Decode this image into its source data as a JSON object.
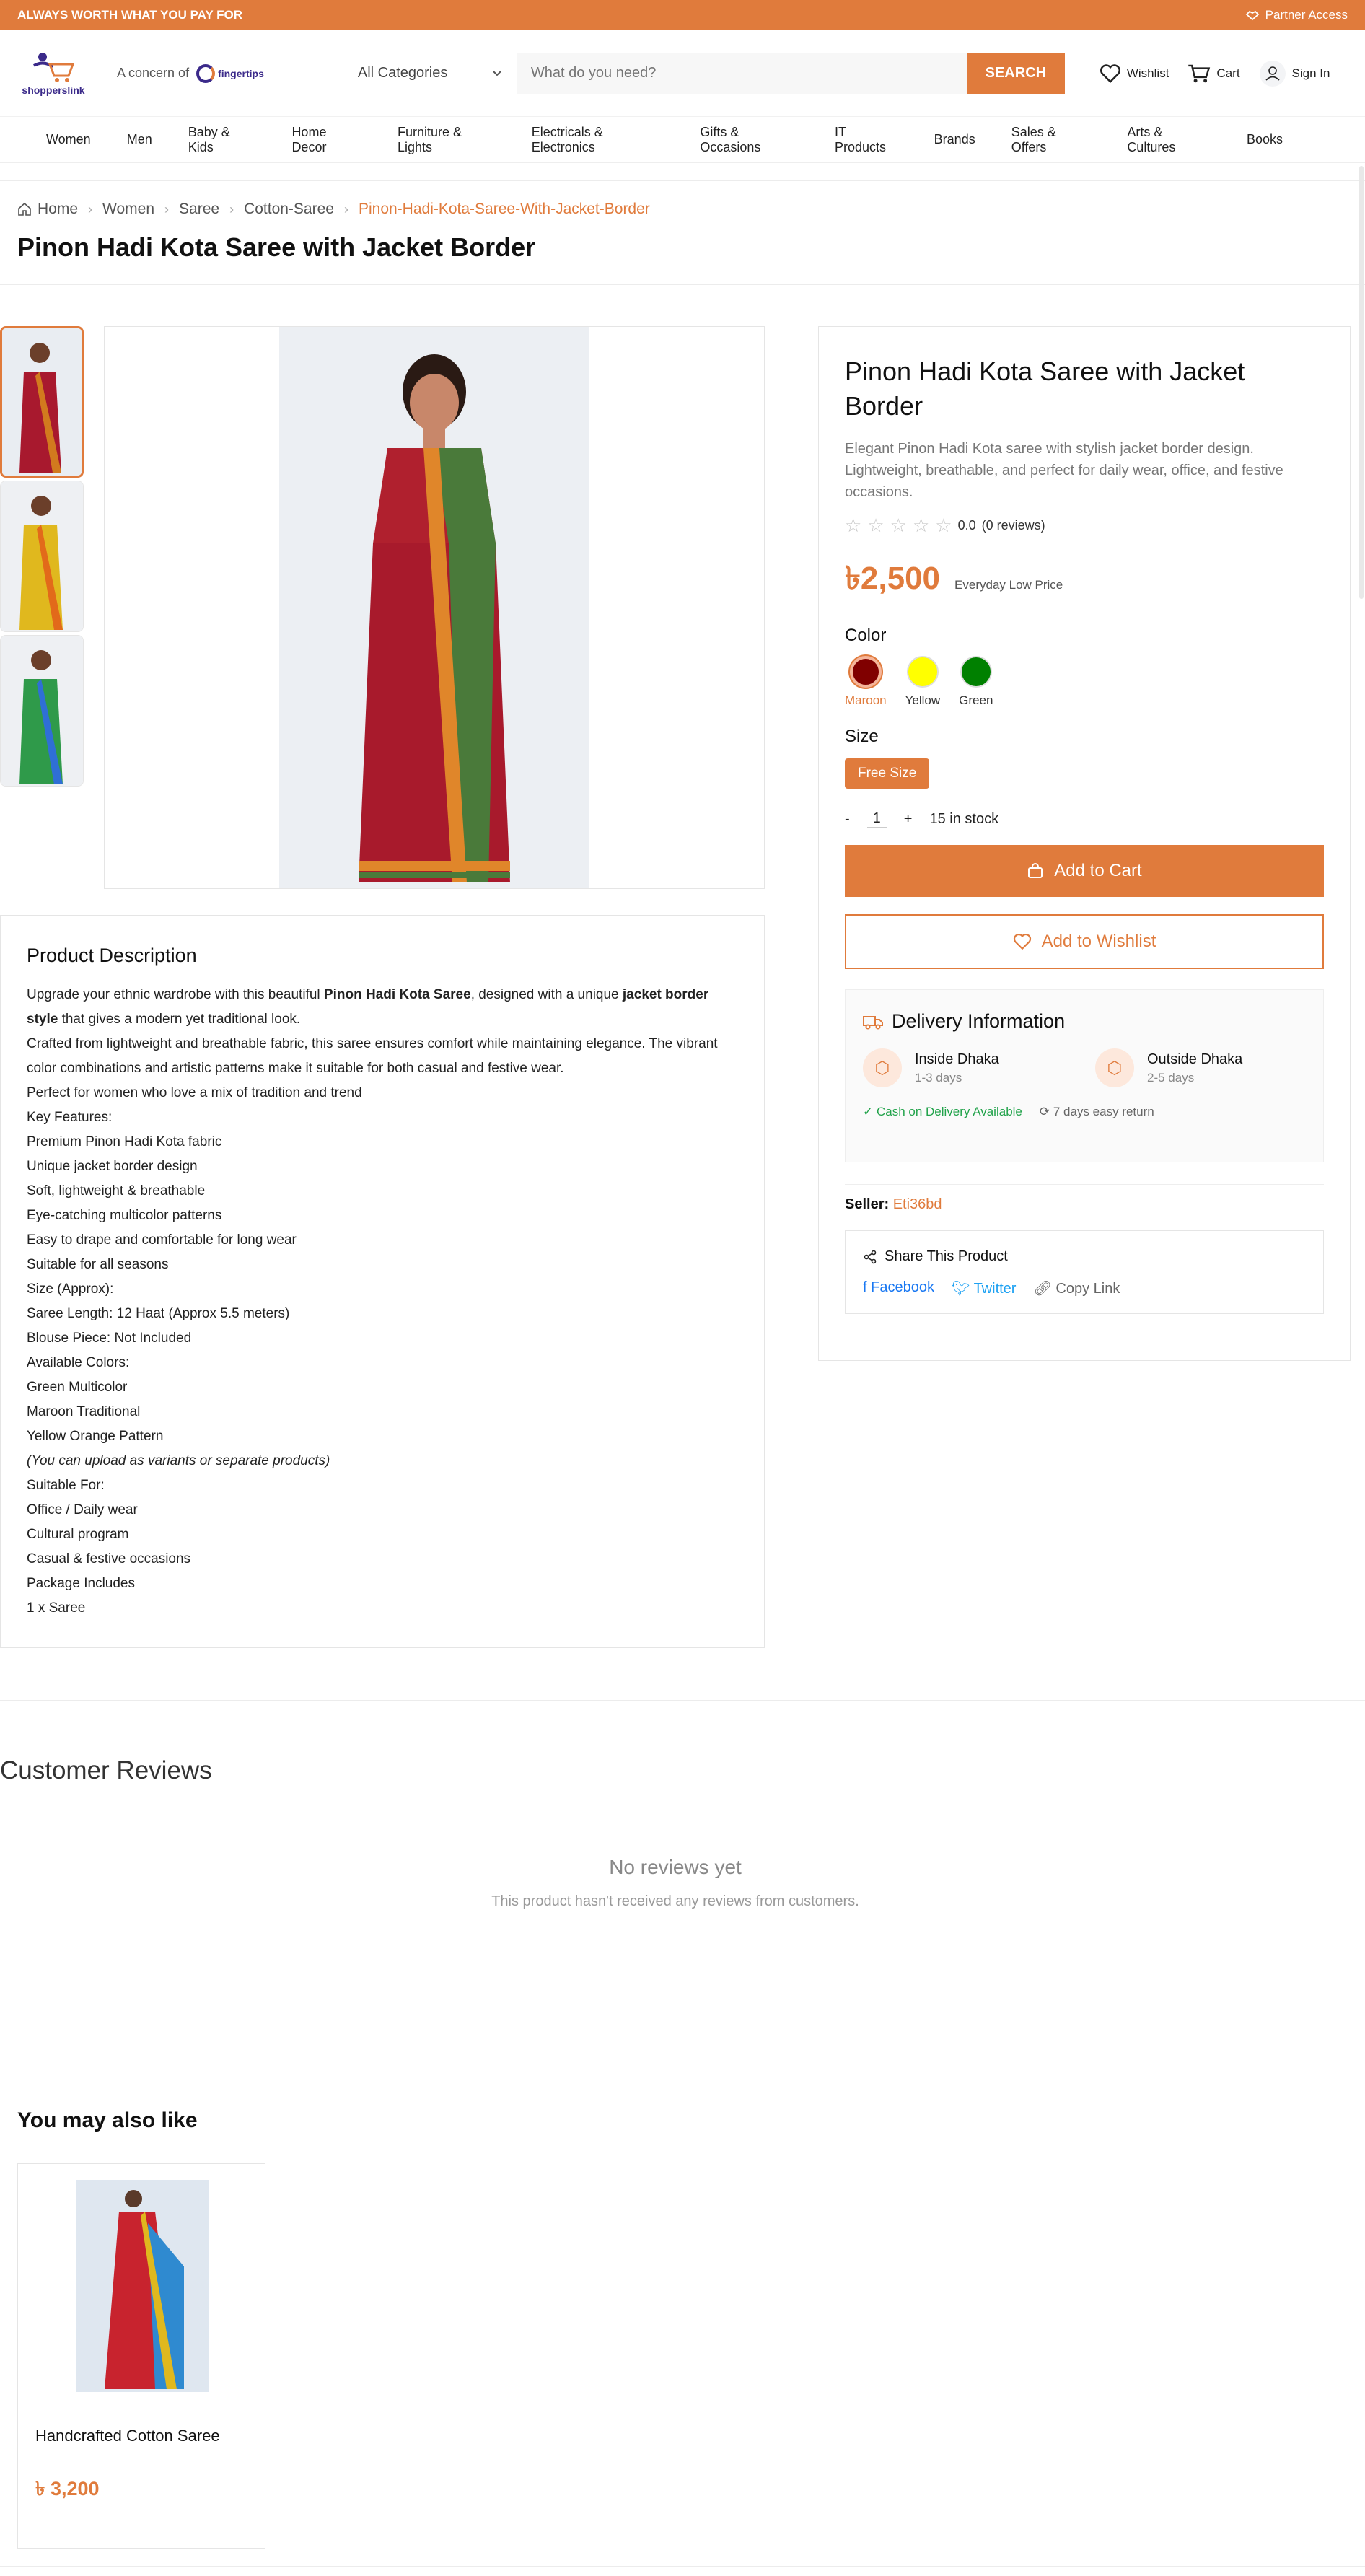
{
  "topbar": {
    "tagline": "ALWAYS WORTH WHAT YOU PAY FOR",
    "partner": "Partner Access"
  },
  "header": {
    "logo_text": "shopperslink",
    "concern_label": "A concern of",
    "concern_brand": "fingertips",
    "category_select": "All Categories",
    "search_placeholder": "What do you need?",
    "search_button": "SEARCH",
    "wishlist": "Wishlist",
    "cart": "Cart",
    "sign_in": "Sign In"
  },
  "nav": [
    "Women",
    "Men",
    "Baby & Kids",
    "Home Decor",
    "Furniture & Lights",
    "Electricals & Electronics",
    "Gifts & Occasions",
    "IT Products",
    "Brands",
    "Sales & Offers",
    "Arts & Cultures",
    "Books"
  ],
  "breadcrumb": {
    "home": "Home",
    "items": [
      "Women",
      "Saree",
      "Cotton-Saree"
    ],
    "current": "Pinon-Hadi-Kota-Saree-With-Jacket-Border"
  },
  "page_title": "Pinon Hadi Kota Saree with Jacket Border",
  "product": {
    "title": "Pinon Hadi Kota Saree with Jacket Border",
    "subtitle": "Elegant Pinon Hadi Kota saree with stylish jacket border design. Lightweight, breathable, and perfect for daily wear, office, and festive occasions.",
    "rating_value": "0.0",
    "rating_stars": 0,
    "reviews_count": "(0 reviews)",
    "price": "৳2,500",
    "price_note": "Everyday Low Price",
    "color_label": "Color",
    "colors": [
      {
        "name": "Maroon",
        "hex": "#800000"
      },
      {
        "name": "Yellow",
        "hex": "#ffff00"
      },
      {
        "name": "Green",
        "hex": "#008000"
      }
    ],
    "selected_color": "Maroon",
    "size_label": "Size",
    "size": "Free Size",
    "qty_minus": "-",
    "qty": "1",
    "qty_plus": "+",
    "stock": "15 in stock",
    "add_to_cart": "Add to Cart",
    "add_to_wishlist": "Add to Wishlist",
    "delivery": {
      "title": "Delivery Information",
      "inside_title": "Inside Dhaka",
      "inside_days": "1-3 days",
      "outside_title": "Outside Dhaka",
      "outside_days": "2-5 days",
      "cod": "Cash on Delivery Available",
      "returns": "7 days easy return"
    },
    "seller_label": "Seller:",
    "seller_name": "Eti36bd",
    "share": {
      "title": "Share This Product",
      "facebook": "Facebook",
      "twitter": "Twitter",
      "copy": "Copy Link"
    }
  },
  "description": {
    "heading": "Product Description",
    "intro_1": "Upgrade your ethnic wardrobe with this beautiful ",
    "intro_bold_1": "Pinon Hadi Kota Saree",
    "intro_2": ", designed with a unique ",
    "intro_bold_2": "jacket border style",
    "intro_3": " that gives a modern yet traditional look.",
    "lines": [
      "Crafted from lightweight and breathable fabric, this saree ensures comfort while maintaining elegance. The vibrant color combinations and artistic patterns make it suitable for both casual and festive wear.",
      "Perfect for women who love a mix of tradition and trend",
      " Key Features:",
      "Premium Pinon Hadi Kota fabric",
      "Unique jacket border design",
      "Soft, lightweight & breathable",
      "Eye-catching multicolor patterns",
      "Easy to drape and comfortable for long wear",
      "Suitable for all seasons",
      " Size (Approx):",
      "Saree Length: 12 Haat (Approx 5.5 meters)",
      "Blouse Piece: Not Included",
      " Available Colors:",
      "Green Multicolor",
      "Maroon Traditional",
      "Yellow Orange Pattern"
    ],
    "italic_line": "(You can upload as variants or separate products)",
    "lines_after": [
      " Suitable For:",
      "Office / Daily wear",
      "Cultural program",
      "Casual & festive occasions",
      " Package Includes",
      "1 x Saree"
    ]
  },
  "reviews": {
    "title": "Customer Reviews",
    "empty_title": "No reviews yet",
    "empty_sub": "This product hasn't received any reviews from customers."
  },
  "related": {
    "title": "You may also like",
    "items": [
      {
        "name": "Handcrafted Cotton Saree",
        "price": "৳ 3,200"
      }
    ]
  },
  "colors": {
    "accent": "#e07b3c",
    "success": "#22a34b"
  }
}
